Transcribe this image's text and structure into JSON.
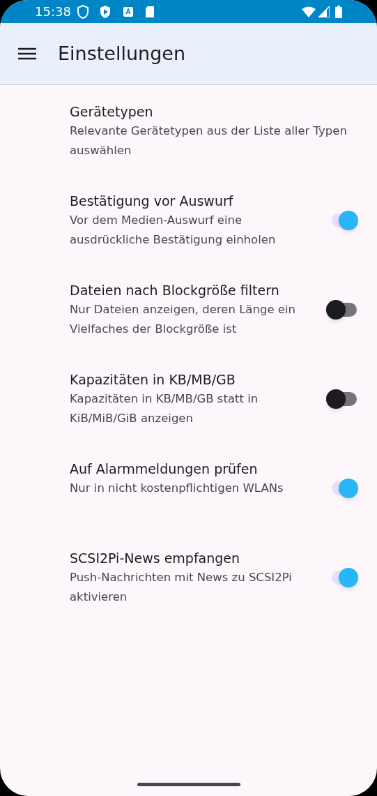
{
  "status_bar": {
    "time": "15:38"
  },
  "app_bar": {
    "title": "Einstellungen"
  },
  "settings": [
    {
      "kind": "text",
      "title": "Gerätetypen",
      "summary": "Relevante Gerätetypen aus der Liste aller Typen auswählen"
    },
    {
      "kind": "switch",
      "title": "Bestätigung vor Auswurf",
      "summary": "Vor dem Medien-Auswurf eine ausdrückliche Bestätigung einholen",
      "on": true
    },
    {
      "kind": "switch",
      "title": "Dateien nach Blockgröße filtern",
      "summary": "Nur Dateien anzeigen, deren Länge ein Vielfaches der Blockgröße ist",
      "on": false
    },
    {
      "kind": "switch",
      "title": "Kapazitäten in KB/MB/GB",
      "summary": "Kapazitäten in KB/MB/GB statt in KiB/MiB/GiB anzeigen",
      "on": false
    },
    {
      "kind": "switch",
      "title": "Auf Alarmmeldungen prüfen",
      "summary": "Nur in nicht kostenpflichtigen WLANs",
      "on": true
    },
    {
      "kind": "switch",
      "title": "SCSI2Pi-News empfangen",
      "summary": "Push-Nachrichten mit News zu SCSI2Pi aktivieren",
      "on": true
    }
  ]
}
